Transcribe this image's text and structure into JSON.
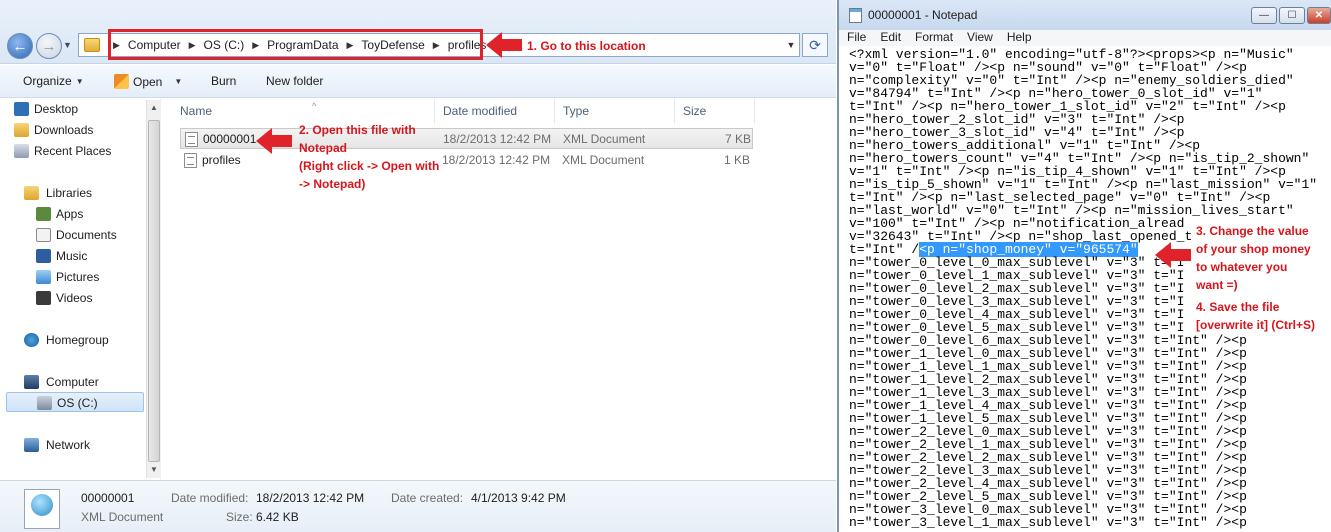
{
  "explorer": {
    "breadcrumbs": [
      "Computer",
      "OS (C:)",
      "ProgramData",
      "ToyDefense",
      "profiles"
    ],
    "toolbar": {
      "organize": "Organize",
      "open": "Open",
      "burn": "Burn",
      "new_folder": "New folder"
    },
    "nav": {
      "favorites": [
        "Desktop",
        "Downloads",
        "Recent Places"
      ],
      "libraries": "Libraries",
      "library_items": [
        "Apps",
        "Documents",
        "Music",
        "Pictures",
        "Videos"
      ],
      "homegroup": "Homegroup",
      "computer": "Computer",
      "drive": "OS (C:)",
      "network": "Network"
    },
    "columns": {
      "name": "Name",
      "date": "Date modified",
      "type": "Type",
      "size": "Size"
    },
    "files": [
      {
        "name": "00000001",
        "date": "18/2/2013 12:42 PM",
        "type": "XML Document",
        "size": "7 KB"
      },
      {
        "name": "profiles",
        "date": "18/2/2013 12:42 PM",
        "type": "XML Document",
        "size": "1 KB"
      }
    ],
    "details": {
      "name": "00000001",
      "type": "XML Document",
      "date_modified_label": "Date modified:",
      "date_modified": "18/2/2013 12:42 PM",
      "size_label": "Size:",
      "size": "6.42 KB",
      "date_created_label": "Date created:",
      "date_created": "4/1/2013 9:42 PM"
    }
  },
  "annotations": {
    "step1": "1. Go to this location",
    "step2_line1": "2. Open this file with",
    "step2_line2": "Notepad",
    "step2_line3": "(Right click -> Open with",
    "step2_line4": "-> Notepad)",
    "step3_line1": "3. Change the value",
    "step3_line2": "of your shop money",
    "step3_line3": "to whatever you",
    "step3_line4": "want =)",
    "step4_line1": "4. Save the file",
    "step4_line2": "[overwrite it] (Ctrl+S)",
    "arrow_color": "#e0232a"
  },
  "notepad": {
    "title": "00000001 - Notepad",
    "window_buttons": {
      "minimize": "—",
      "maximize": "☐",
      "close": "✕"
    },
    "menu": [
      "File",
      "Edit",
      "Format",
      "View",
      "Help"
    ],
    "lines": [
      "<?xml version=\"1.0\" encoding=\"utf-8\"?><props><p n=\"Music\"",
      "v=\"0\" t=\"Float\" /><p n=\"sound\" v=\"0\" t=\"Float\" /><p",
      "n=\"complexity\" v=\"0\" t=\"Int\" /><p n=\"enemy_soldiers_died\"",
      "v=\"84794\" t=\"Int\" /><p n=\"hero_tower_0_slot_id\" v=\"1\"",
      "t=\"Int\" /><p n=\"hero_tower_1_slot_id\" v=\"2\" t=\"Int\" /><p",
      "n=\"hero_tower_2_slot_id\" v=\"3\" t=\"Int\" /><p",
      "n=\"hero_tower_3_slot_id\" v=\"4\" t=\"Int\" /><p",
      "n=\"hero_towers_additional\" v=\"1\" t=\"Int\" /><p",
      "n=\"hero_towers_count\" v=\"4\" t=\"Int\" /><p n=\"is_tip_2_shown\"",
      "v=\"1\" t=\"Int\" /><p n=\"is_tip_4_shown\" v=\"1\" t=\"Int\" /><p",
      "n=\"is_tip_5_shown\" v=\"1\" t=\"Int\" /><p n=\"last_mission\" v=\"1\"",
      "t=\"Int\" /><p n=\"last_selected_page\" v=\"0\" t=\"Int\" /><p",
      "n=\"last_world\" v=\"0\" t=\"Int\" /><p n=\"mission_lives_start\"",
      "v=\"100\" t=\"Int\" /><p n=\"notification_alread",
      "v=\"32643\" t=\"Int\" /><p n=\"shop_last_opened_t",
      "t=\"Int\" /",
      "n=\"tower_0_level_0_max_sublevel\" v=\"3\" t=\"I",
      "n=\"tower_0_level_1_max_sublevel\" v=\"3\" t=\"I",
      "n=\"tower_0_level_2_max_sublevel\" v=\"3\" t=\"I",
      "n=\"tower_0_level_3_max_sublevel\" v=\"3\" t=\"I",
      "n=\"tower_0_level_4_max_sublevel\" v=\"3\" t=\"I",
      "n=\"tower_0_level_5_max_sublevel\" v=\"3\" t=\"I",
      "n=\"tower_0_level_6_max_sublevel\" v=\"3\" t=\"Int\" /><p",
      "n=\"tower_1_level_0_max_sublevel\" v=\"3\" t=\"Int\" /><p",
      "n=\"tower_1_level_1_max_sublevel\" v=\"3\" t=\"Int\" /><p",
      "n=\"tower_1_level_2_max_sublevel\" v=\"3\" t=\"Int\" /><p",
      "n=\"tower_1_level_3_max_sublevel\" v=\"3\" t=\"Int\" /><p",
      "n=\"tower_1_level_4_max_sublevel\" v=\"3\" t=\"Int\" /><p",
      "n=\"tower_1_level_5_max_sublevel\" v=\"3\" t=\"Int\" /><p",
      "n=\"tower_2_level_0_max_sublevel\" v=\"3\" t=\"Int\" /><p",
      "n=\"tower_2_level_1_max_sublevel\" v=\"3\" t=\"Int\" /><p",
      "n=\"tower_2_level_2_max_sublevel\" v=\"3\" t=\"Int\" /><p",
      "n=\"tower_2_level_3_max_sublevel\" v=\"3\" t=\"Int\" /><p",
      "n=\"tower_2_level_4_max_sublevel\" v=\"3\" t=\"Int\" /><p",
      "n=\"tower_2_level_5_max_sublevel\" v=\"3\" t=\"Int\" /><p",
      "n=\"tower_3_level_0_max_sublevel\" v=\"3\" t=\"Int\" /><p",
      "n=\"tower_3_level_1_max_sublevel\" v=\"3\" t=\"Int\" /><p"
    ],
    "highlight_line_index": 15,
    "highlight_text": "<p n=\"shop_money\" v=\"965574\""
  }
}
